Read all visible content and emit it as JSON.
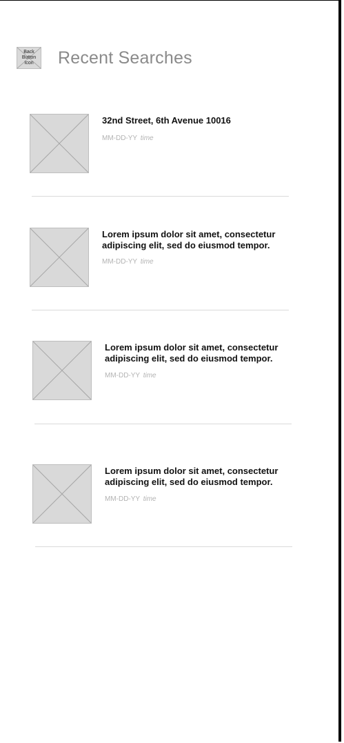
{
  "header": {
    "back_button_label": "Back Button Icon",
    "title": "Recent Searches"
  },
  "items": [
    {
      "title": "32nd Street, 6th Avenue 10016",
      "date": "MM-DD-YY",
      "time": "time"
    },
    {
      "title": "Lorem ipsum dolor sit amet, consectetur adipiscing elit, sed do eiusmod tempor.",
      "date": "MM-DD-YY",
      "time": "time"
    },
    {
      "title": "Lorem ipsum dolor sit amet, consectetur adipiscing elit, sed do eiusmod tempor.",
      "date": "MM-DD-YY",
      "time": "time"
    },
    {
      "title": "Lorem ipsum dolor sit amet, consectetur adipiscing elit, sed do eiusmod tempor.",
      "date": "MM-DD-YY",
      "time": "time"
    }
  ]
}
